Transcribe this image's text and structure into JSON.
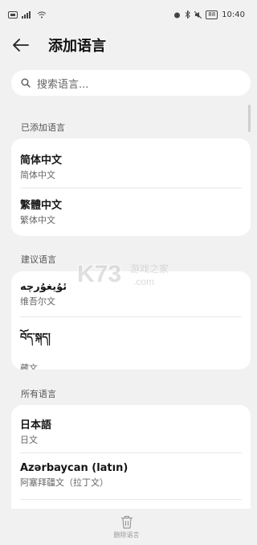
{
  "status_bar": {
    "time": "10:40",
    "battery": "88"
  },
  "header": {
    "title": "添加语言"
  },
  "search": {
    "placeholder": "搜索语言..."
  },
  "sections": {
    "added": "已添加语言",
    "suggested": "建议语言",
    "all": "所有语言"
  },
  "added_languages": [
    {
      "name": "简体中文",
      "desc": "简体中文"
    },
    {
      "name": "繁體中文",
      "desc": "繁体中文"
    }
  ],
  "suggested_languages": [
    {
      "name": "ئۇيغۇرچە",
      "desc": "维吾尔文"
    },
    {
      "name": "བོད་སྐད།",
      "desc": "藏文"
    }
  ],
  "all_languages": [
    {
      "name": "日本語",
      "desc": "日文"
    },
    {
      "name": "Azərbaycan (latın)",
      "desc": "阿塞拜疆文（拉丁文）"
    }
  ],
  "bottom": {
    "delete_label": "删除语言"
  },
  "watermark": {
    "brand": "K73",
    "cn": "游戏之家",
    "domain": ".com"
  },
  "colors": {
    "background": "#f1f1f1",
    "card": "#ffffff",
    "accent_watermark": "#c9c9c9"
  }
}
